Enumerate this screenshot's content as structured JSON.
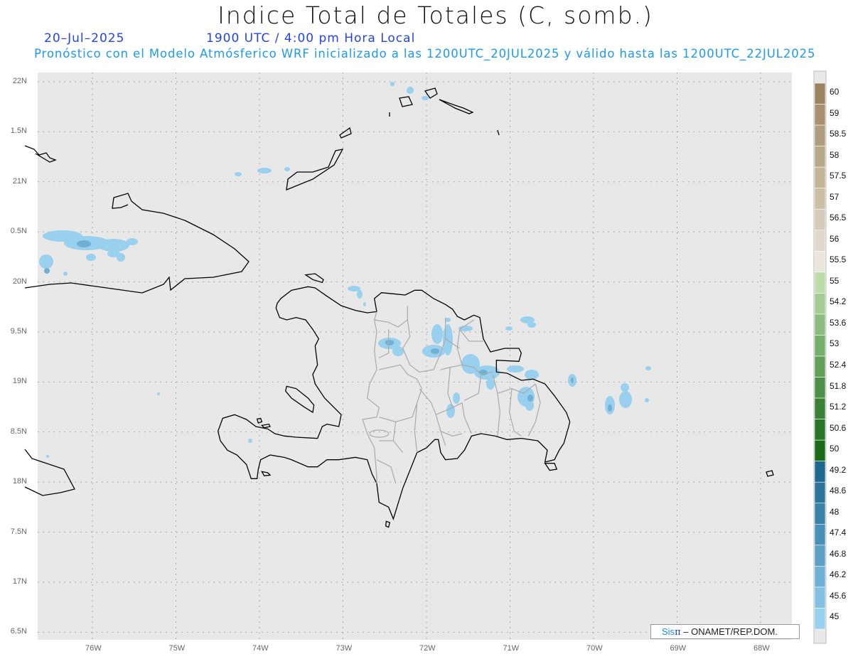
{
  "header": {
    "title": "Indice Total de Totales (C, somb.)",
    "date": "20–Jul–2025",
    "time": "1900 UTC / 4:00 pm Hora Local",
    "subtitle": "Pronóstico con el Modelo Atmósferico WRF inicializado a las 1200UTC_20JUL2025 y válido hasta las  1200UTC_22JUL2025"
  },
  "map": {
    "lon_labels": [
      "76W",
      "75W",
      "74W",
      "73W",
      "72W",
      "71W",
      "70W",
      "69W",
      "68W"
    ],
    "lat_labels": [
      "22N",
      "1.5N",
      "21N",
      "0.5N",
      "20N",
      "9.5N",
      "19N",
      "8.5N",
      "18N",
      "7.5N",
      "17N",
      "6.5N"
    ],
    "background_color": "#e8e8e8",
    "coast_color": "#000000",
    "province_color": "#aaaaaa"
  },
  "colorbar": {
    "labels": [
      "60",
      "59",
      "58.5",
      "58",
      "57.5",
      "57",
      "56.5",
      "56",
      "55.5",
      "55",
      "54.2",
      "53.6",
      "53",
      "52.4",
      "51.8",
      "51.2",
      "50.6",
      "50",
      "49.2",
      "48.6",
      "48",
      "47.4",
      "46.8",
      "46.2",
      "45.6",
      "45"
    ],
    "colors": [
      "#9a8460",
      "#a89070",
      "#b09c7e",
      "#b8a88a",
      "#c4b498",
      "#ccbfa8",
      "#d6cbb8",
      "#e0d8ca",
      "#eae6dc",
      "#bcdcaa",
      "#a6cc96",
      "#8cbc80",
      "#76ae6c",
      "#62a05a",
      "#4c904a",
      "#3a8036",
      "#2a7428",
      "#1a6a1a",
      "#1e6a8e",
      "#2c7498",
      "#3a82a8",
      "#4a90b6",
      "#5ea0c4",
      "#70b0d4",
      "#84c0e2",
      "#98d0ee"
    ]
  },
  "logo": {
    "sis": "Sis",
    "pi": "π",
    "rest": "–  ONAMET/REP.DOM."
  }
}
